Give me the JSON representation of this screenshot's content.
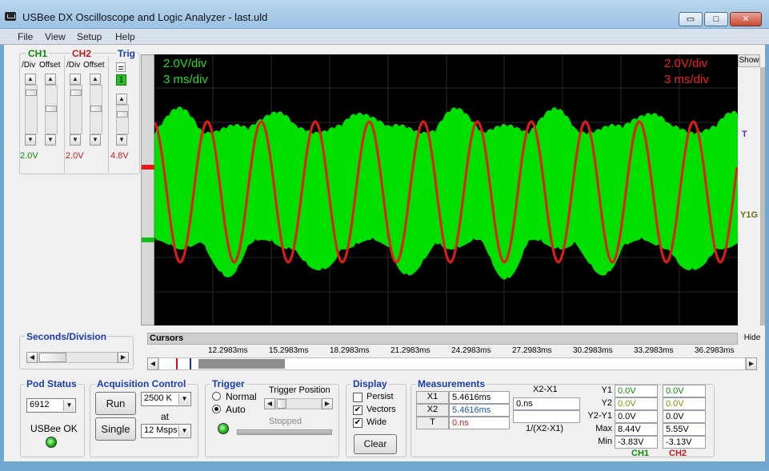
{
  "window": {
    "title": "USBee DX Oscilloscope and Logic Analyzer - last.uld",
    "min_label": "▭",
    "max_label": "□",
    "close_label": "✕"
  },
  "menu": [
    "File",
    "View",
    "Setup",
    "Help"
  ],
  "channels": {
    "ch1": {
      "label": "CH1",
      "div_label": "/Div",
      "offset_label": "Offset",
      "volts": "2.0V",
      "color": "#00e000"
    },
    "ch2": {
      "label": "CH2",
      "div_label": "/Div",
      "offset_label": "Offset",
      "volts": "2.0V",
      "color": "#e41b17"
    },
    "trig": {
      "label": "Trig",
      "indicator": "1",
      "volts": "4.8V"
    }
  },
  "scope": {
    "ch1_scale": "2.0V/div",
    "ch1_time": "3 ms/div",
    "ch2_scale": "2.0V/div",
    "ch2_time": "3 ms/div",
    "show_label": "Show",
    "marker_t": "T",
    "marker_y1g": "Y1G"
  },
  "seconds_division": {
    "label": "Seconds/Division"
  },
  "cursors": {
    "label": "Cursors",
    "hide_label": "Hide",
    "timestamps": [
      "12.2983ms",
      "15.2983ms",
      "18.2983ms",
      "21.2983ms",
      "24.2983ms",
      "27.2983ms",
      "30.2983ms",
      "33.2983ms",
      "36.2983ms"
    ]
  },
  "pod_status": {
    "label": "Pod Status",
    "pod_id": "6912",
    "status": "USBee OK"
  },
  "acquisition": {
    "label": "Acquisition Control",
    "run": "Run",
    "single": "Single",
    "samples": "2500 K",
    "at": "at",
    "rate": "12 Msps"
  },
  "trigger": {
    "label": "Trigger",
    "normal": "Normal",
    "auto": "Auto",
    "position_label": "Trigger Position",
    "status": "Stopped"
  },
  "display": {
    "label": "Display",
    "persist": "Persist",
    "vectors": "Vectors",
    "wide": "Wide",
    "clear": "Clear"
  },
  "measurements": {
    "label": "Measurements",
    "x1_label": "X1",
    "x1_value": "5.4616ms",
    "x2_label": "X2",
    "x2_value": "5.4616ms",
    "t_label": "T",
    "t_value": "0.ns",
    "x2x1_label": "X2-X1",
    "x2x1_value": "0.ns",
    "inv_label": "1/(X2-X1)",
    "inv_value": "",
    "rows": [
      {
        "label": "Y1",
        "ch1": "0.0V",
        "ch2": "0.0V"
      },
      {
        "label": "Y2",
        "ch1": "0.0V",
        "ch2": "0.0V"
      },
      {
        "label": "Y2-Y1",
        "ch1": "0.0V",
        "ch2": "0.0V"
      },
      {
        "label": "Max",
        "ch1": "8.44V",
        "ch2": "5.55V"
      },
      {
        "label": "Min",
        "ch1": "-3.83V",
        "ch2": "-3.13V"
      }
    ],
    "ch1_footer": "CH1",
    "ch2_footer": "CH2"
  }
}
